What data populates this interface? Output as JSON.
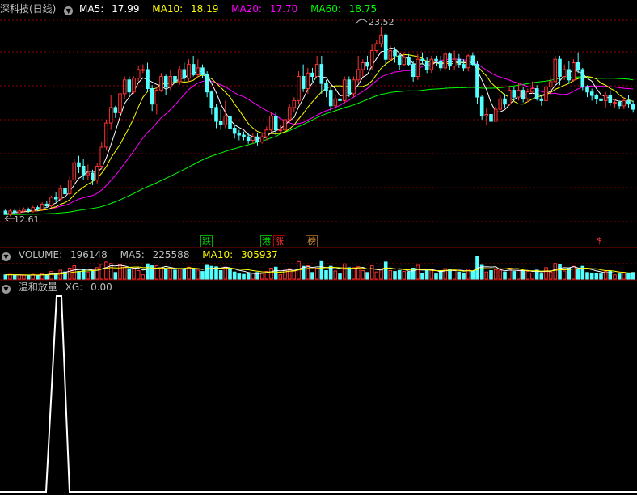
{
  "main_panel": {
    "title": "深科技(日线)",
    "indicators": [
      {
        "label": "MA5: ",
        "value": "17.99",
        "color": "#ffffff"
      },
      {
        "label": "MA10: ",
        "value": "18.19",
        "color": "#ffff00"
      },
      {
        "label": "MA20: ",
        "value": "17.70",
        "color": "#ff00ff"
      },
      {
        "label": "MA60: ",
        "value": "18.75",
        "color": "#00ff00"
      }
    ],
    "high_label": "23.52",
    "low_label": "12.61",
    "event_tags": [
      {
        "text": "跌",
        "color": "#00cc00"
      },
      {
        "text": "港",
        "color": "#00cc00"
      },
      {
        "text": "涨",
        "color": "#ff3333"
      },
      {
        "text": "榜",
        "color": "#cc8833"
      },
      {
        "text": "$",
        "color": "#ff3333"
      }
    ]
  },
  "volume_panel": {
    "indicators": [
      {
        "label": "VOLUME: ",
        "value": "196148",
        "color": "#c0c0c0"
      },
      {
        "label": "MA5: ",
        "value": "225588",
        "color": "#c0c0c0"
      },
      {
        "label": "MA10: ",
        "value": "305937",
        "color": "#ffff00"
      }
    ]
  },
  "signal_panel": {
    "title": "温和放量",
    "indicators": [
      {
        "label": "XG: ",
        "value": "0.00",
        "color": "#c0c0c0"
      }
    ]
  },
  "colors": {
    "up": "#ff3232",
    "down": "#54ffff",
    "grid": "#8b0000",
    "ma5": "#ffffff",
    "ma10": "#ffff00",
    "ma20": "#ff00ff",
    "ma60": "#00ff00",
    "xg": "#ffffff"
  },
  "chart_data": {
    "type": "candlestick",
    "ylim": [
      12.0,
      24.0
    ],
    "candles": [
      [
        12.8,
        12.6,
        12.9,
        12.6
      ],
      [
        12.6,
        12.8,
        12.9,
        12.5
      ],
      [
        12.8,
        12.7,
        12.9,
        12.6
      ],
      [
        12.7,
        12.8,
        13.0,
        12.6
      ],
      [
        12.8,
        12.9,
        13.0,
        12.7
      ],
      [
        12.9,
        12.8,
        13.0,
        12.7
      ],
      [
        12.8,
        13.0,
        13.1,
        12.7
      ],
      [
        13.0,
        12.9,
        13.1,
        12.8
      ],
      [
        12.9,
        13.2,
        13.3,
        12.8
      ],
      [
        13.2,
        13.1,
        13.4,
        13.0
      ],
      [
        13.1,
        13.6,
        13.7,
        13.0
      ],
      [
        13.6,
        13.5,
        13.9,
        13.3
      ],
      [
        13.5,
        14.1,
        14.3,
        13.4
      ],
      [
        14.1,
        13.8,
        14.4,
        13.6
      ],
      [
        13.8,
        14.6,
        14.8,
        13.7
      ],
      [
        14.6,
        15.6,
        15.8,
        14.4
      ],
      [
        15.6,
        15.4,
        16.0,
        15.0
      ],
      [
        15.4,
        14.9,
        15.8,
        14.6
      ],
      [
        14.9,
        15.0,
        15.5,
        14.6
      ],
      [
        15.0,
        14.6,
        15.2,
        14.3
      ],
      [
        14.6,
        15.4,
        15.6,
        14.4
      ],
      [
        15.4,
        16.5,
        16.8,
        15.2
      ],
      [
        16.5,
        17.9,
        18.1,
        16.3
      ],
      [
        17.9,
        18.8,
        19.5,
        17.5
      ],
      [
        18.8,
        18.5,
        18.9,
        18.2
      ],
      [
        18.5,
        19.6,
        19.9,
        18.3
      ],
      [
        19.6,
        20.4,
        20.6,
        19.3
      ],
      [
        20.4,
        19.7,
        20.6,
        19.5
      ],
      [
        19.7,
        20.5,
        20.6,
        19.6
      ],
      [
        20.5,
        21.0,
        21.2,
        20.3
      ],
      [
        21.0,
        21.0,
        21.3,
        20.8
      ],
      [
        21.0,
        19.9,
        21.4,
        19.7
      ],
      [
        19.9,
        19.0,
        20.1,
        18.6
      ],
      [
        19.0,
        19.8,
        20.0,
        18.4
      ],
      [
        19.8,
        20.6,
        20.8,
        19.7
      ],
      [
        20.6,
        20.0,
        20.7,
        19.5
      ],
      [
        20.0,
        20.6,
        21.0,
        19.8
      ],
      [
        20.6,
        20.3,
        21.0,
        19.8
      ],
      [
        20.3,
        21.0,
        21.2,
        20.1
      ],
      [
        21.0,
        20.5,
        21.4,
        20.3
      ],
      [
        20.5,
        21.3,
        21.6,
        20.3
      ],
      [
        21.3,
        20.7,
        21.8,
        20.6
      ],
      [
        20.7,
        21.1,
        21.6,
        20.5
      ],
      [
        21.1,
        20.7,
        21.3,
        20.5
      ],
      [
        20.7,
        19.7,
        20.9,
        19.4
      ],
      [
        19.7,
        18.8,
        19.8,
        18.4
      ],
      [
        18.8,
        18.0,
        19.0,
        17.6
      ],
      [
        18.0,
        17.8,
        18.7,
        17.5
      ],
      [
        17.8,
        18.3,
        19.2,
        17.6
      ],
      [
        18.3,
        17.6,
        18.5,
        17.3
      ],
      [
        17.6,
        17.3,
        17.8,
        17.0
      ],
      [
        17.3,
        17.2,
        17.5,
        16.9
      ],
      [
        17.2,
        17.1,
        17.4,
        16.9
      ],
      [
        17.1,
        16.9,
        17.3,
        16.7
      ],
      [
        16.9,
        17.1,
        17.3,
        16.7
      ],
      [
        17.1,
        16.8,
        17.3,
        16.6
      ],
      [
        16.8,
        17.1,
        17.3,
        16.7
      ],
      [
        17.1,
        17.5,
        17.7,
        16.9
      ],
      [
        17.5,
        18.3,
        18.5,
        17.4
      ],
      [
        18.3,
        17.5,
        18.5,
        17.2
      ],
      [
        17.5,
        17.5,
        17.8,
        17.3
      ],
      [
        17.5,
        18.1,
        18.3,
        17.4
      ],
      [
        18.1,
        18.8,
        19.0,
        17.9
      ],
      [
        18.8,
        19.2,
        19.4,
        18.5
      ],
      [
        19.2,
        20.6,
        20.9,
        19.0
      ],
      [
        20.6,
        19.9,
        21.3,
        19.7
      ],
      [
        19.9,
        20.8,
        21.1,
        19.6
      ],
      [
        20.8,
        20.6,
        21.1,
        20.3
      ],
      [
        20.6,
        21.3,
        21.8,
        20.6
      ],
      [
        21.3,
        20.2,
        21.8,
        19.6
      ],
      [
        20.2,
        19.8,
        20.4,
        19.4
      ],
      [
        19.8,
        18.9,
        20.0,
        18.6
      ],
      [
        18.9,
        19.3,
        19.5,
        18.6
      ],
      [
        19.3,
        19.2,
        19.5,
        18.9
      ],
      [
        19.2,
        20.4,
        20.6,
        19.0
      ],
      [
        20.4,
        19.6,
        20.6,
        19.4
      ],
      [
        19.6,
        20.4,
        20.6,
        19.4
      ],
      [
        20.4,
        21.0,
        21.8,
        20.2
      ],
      [
        21.0,
        21.4,
        21.6,
        20.6
      ],
      [
        21.4,
        21.2,
        21.8,
        21.0
      ],
      [
        21.2,
        22.1,
        22.5,
        21.0
      ],
      [
        22.1,
        22.5,
        22.7,
        22.0
      ],
      [
        22.5,
        23.0,
        23.5,
        22.3
      ],
      [
        23.0,
        21.6,
        23.1,
        21.3
      ],
      [
        21.6,
        22.1,
        22.4,
        21.5
      ],
      [
        22.1,
        21.8,
        22.3,
        21.4
      ],
      [
        21.8,
        21.3,
        21.9,
        21.0
      ],
      [
        21.3,
        21.7,
        22.0,
        21.2
      ],
      [
        21.7,
        21.3,
        21.9,
        21.2
      ],
      [
        21.3,
        20.6,
        21.5,
        20.3
      ],
      [
        20.6,
        21.6,
        21.9,
        20.4
      ],
      [
        21.6,
        21.5,
        22.0,
        21.3
      ],
      [
        21.5,
        21.0,
        21.7,
        20.8
      ],
      [
        21.0,
        21.6,
        21.8,
        20.8
      ],
      [
        21.6,
        21.5,
        21.8,
        21.2
      ],
      [
        21.5,
        21.1,
        21.8,
        20.9
      ],
      [
        21.1,
        21.9,
        22.0,
        21.0
      ],
      [
        21.9,
        21.2,
        22.0,
        21.0
      ],
      [
        21.2,
        21.6,
        22.1,
        21.0
      ],
      [
        21.6,
        21.3,
        21.9,
        21.1
      ],
      [
        21.3,
        21.1,
        21.6,
        20.9
      ],
      [
        21.1,
        21.8,
        21.9,
        20.9
      ],
      [
        21.8,
        21.3,
        22.0,
        21.2
      ],
      [
        21.3,
        19.4,
        21.5,
        19.0
      ],
      [
        19.4,
        18.3,
        19.5,
        18.1
      ],
      [
        18.3,
        18.4,
        18.8,
        17.8
      ],
      [
        18.4,
        18.0,
        18.6,
        17.6
      ],
      [
        18.0,
        18.7,
        18.9,
        18.0
      ],
      [
        18.7,
        19.3,
        19.5,
        18.6
      ],
      [
        19.3,
        19.0,
        19.6,
        18.8
      ],
      [
        19.0,
        19.8,
        20.0,
        18.9
      ],
      [
        19.8,
        19.4,
        20.0,
        19.2
      ],
      [
        19.4,
        19.8,
        20.2,
        19.2
      ],
      [
        19.8,
        19.3,
        20.0,
        19.1
      ],
      [
        19.3,
        19.7,
        19.9,
        19.1
      ],
      [
        19.7,
        19.9,
        20.3,
        19.6
      ],
      [
        19.9,
        19.3,
        20.1,
        19.2
      ],
      [
        19.3,
        19.2,
        19.5,
        18.9
      ],
      [
        19.2,
        20.0,
        20.2,
        19.0
      ],
      [
        20.0,
        20.3,
        20.6,
        19.8
      ],
      [
        20.3,
        21.6,
        21.8,
        20.2
      ],
      [
        21.6,
        20.6,
        21.8,
        20.1
      ],
      [
        20.6,
        21.0,
        21.3,
        20.4
      ],
      [
        21.0,
        20.4,
        21.5,
        20.2
      ],
      [
        20.4,
        21.4,
        21.6,
        20.3
      ],
      [
        21.4,
        21.0,
        22.0,
        20.8
      ],
      [
        21.0,
        20.0,
        21.1,
        19.8
      ],
      [
        20.0,
        19.7,
        20.1,
        19.4
      ],
      [
        19.7,
        19.5,
        19.9,
        19.2
      ],
      [
        19.5,
        19.3,
        19.6,
        19.0
      ],
      [
        19.3,
        19.2,
        19.5,
        18.9
      ],
      [
        19.2,
        19.5,
        19.7,
        18.8
      ],
      [
        19.5,
        19.1,
        19.8,
        18.9
      ],
      [
        19.1,
        19.1,
        19.3,
        18.8
      ],
      [
        19.1,
        18.9,
        19.2,
        18.7
      ],
      [
        18.9,
        19.2,
        19.4,
        18.7
      ],
      [
        19.2,
        19.0,
        19.5,
        18.8
      ],
      [
        19.0,
        18.7,
        19.2,
        18.5
      ]
    ],
    "volume_ylim": [
      0,
      1100000
    ],
    "xg_signal": [
      {
        "x": 0,
        "y": 0
      },
      {
        "x": 57,
        "y": 0
      },
      {
        "x": 70,
        "y": 1
      },
      {
        "x": 76,
        "y": 1
      },
      {
        "x": 86,
        "y": 0
      },
      {
        "x": 788,
        "y": 0
      }
    ]
  }
}
